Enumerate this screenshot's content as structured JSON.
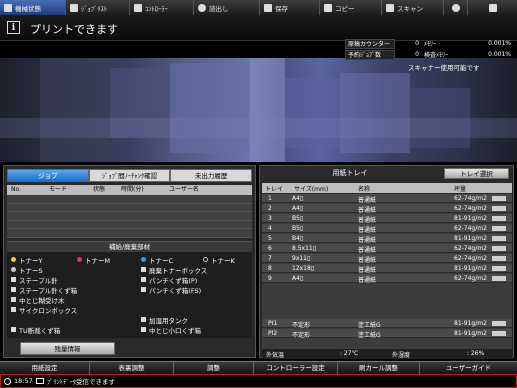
{
  "topbar": {
    "tabs": [
      {
        "label": "機械状態",
        "icon": "machine-icon"
      },
      {
        "label": "ｼﾞｮﾌﾞﾘｽﾄ",
        "icon": "list-icon"
      },
      {
        "label": "ｺﾝﾄﾛｰﾗｰ",
        "icon": "controller-icon"
      },
      {
        "label": "読出し",
        "icon": "readout-icon"
      },
      {
        "label": "保存",
        "icon": "save-icon"
      },
      {
        "label": "コピー",
        "icon": "copy-icon"
      },
      {
        "label": "スキャン",
        "icon": "scan-icon"
      },
      {
        "label": "",
        "icon": "globe-icon"
      },
      {
        "label": "",
        "icon": "menu-icon"
      }
    ]
  },
  "header": {
    "title": "プリントできます",
    "counters": {
      "row1": {
        "label": "原稿カウンター",
        "value": "0",
        "label2": "ﾒﾓﾘｰ",
        "value2": "0.001%"
      },
      "row2": {
        "label": "予約ｼﾞｮﾌﾞ数",
        "value": "0",
        "label2": "検査ﾒﾓﾘｰ",
        "value2": "0.001%"
      }
    },
    "scanner_status": "スキャナー使用可能です"
  },
  "jobs": {
    "tabs": [
      "ジョブ",
      "ｼﾞｮﾌﾞ間ﾉｰﾁｬﾝｸ確認",
      "未出力履歴"
    ],
    "columns": [
      "No.",
      "モード",
      "状態",
      "時間(分)",
      "ユーザー名"
    ]
  },
  "supplies": {
    "title": "補給/廃棄部材",
    "items": [
      {
        "label": "トナーY",
        "color": "#f2d21b"
      },
      {
        "label": "トナーM",
        "color": "#e0307a"
      },
      {
        "label": "トナーC",
        "color": "#1fa6e0"
      },
      {
        "label": "トナーK",
        "color": "#111111"
      },
      {
        "label": "トナーS",
        "color": "#cccccc"
      },
      {
        "label": "廃棄トナーボックス",
        "color": "#cccccc"
      },
      {
        "label": "ステープル針",
        "color": "#cccccc"
      },
      {
        "label": "パンチくず箱(P)",
        "color": "#cccccc"
      },
      {
        "label": "ステープル針くず箱",
        "color": "#cccccc"
      },
      {
        "label": "パンチくず箱(FS)",
        "color": "#cccccc"
      },
      {
        "label": "中とじ糊受け木",
        "color": "#cccccc"
      },
      {
        "label": "サイクロンボックス",
        "color": "#cccccc"
      },
      {
        "label": "加湿用タンク",
        "color": "#cccccc"
      },
      {
        "label": "TU断裁くず箱",
        "color": "#cccccc"
      },
      {
        "label": "中とじ小口くず箱",
        "color": "#cccccc"
      }
    ],
    "remain_button": "残量情報"
  },
  "trays": {
    "title": "用紙トレイ",
    "select_button": "トレイ選択",
    "columns": [
      "トレイ",
      "サイズ(mm)",
      "名称",
      "坪量"
    ],
    "rows": [
      {
        "tray": "1",
        "size": "A4▯",
        "name": "普通紙",
        "weight": "62-74g/m2",
        "level": 1.0
      },
      {
        "tray": "2",
        "size": "A4▯",
        "name": "普通紙",
        "weight": "62-74g/m2",
        "level": 1.0
      },
      {
        "tray": "3",
        "size": "B5▯",
        "name": "普通紙",
        "weight": "81-91g/m2",
        "level": 1.0
      },
      {
        "tray": "4",
        "size": "B5▯",
        "name": "普通紙",
        "weight": "62-74g/m2",
        "level": 1.0
      },
      {
        "tray": "5",
        "size": "B4▯",
        "name": "普通紙",
        "weight": "81-91g/m2",
        "level": 1.0
      },
      {
        "tray": "6",
        "size": "8.5x11▯",
        "name": "普通紙",
        "weight": "62-74g/m2",
        "level": 1.0
      },
      {
        "tray": "7",
        "size": "9x11▯",
        "name": "普通紙",
        "weight": "62-74g/m2",
        "level": 1.0
      },
      {
        "tray": "8",
        "size": "12x18▯",
        "name": "普通紙",
        "weight": "81-91g/m2",
        "level": 1.0
      },
      {
        "tray": "9",
        "size": "A4▯",
        "name": "普通紙",
        "weight": "62-74g/m2",
        "level": 1.0
      }
    ],
    "pi_rows": [
      {
        "tray": "PI1",
        "size": "不定形",
        "name": "塗工紙G",
        "weight": "81-91g/m2",
        "level": 1.0
      },
      {
        "tray": "PI2",
        "size": "不定形",
        "name": "塗工紙G",
        "weight": "81-91g/m2",
        "level": 1.0
      }
    ],
    "weather": {
      "temp_label": "外気温",
      "temp_value": ": 27℃",
      "hum_label": "外湿度",
      "hum_value": ": 26%"
    }
  },
  "bottom": {
    "buttons": [
      "用紙設定",
      "表裏調整",
      "調整",
      "コントローラー設定",
      "刷カール調整",
      "ユーザーガイド"
    ]
  },
  "status": {
    "time": "18:57",
    "message": "ﾌﾟﾘﾝﾄﾃﾞｰﾀ受信できます"
  }
}
